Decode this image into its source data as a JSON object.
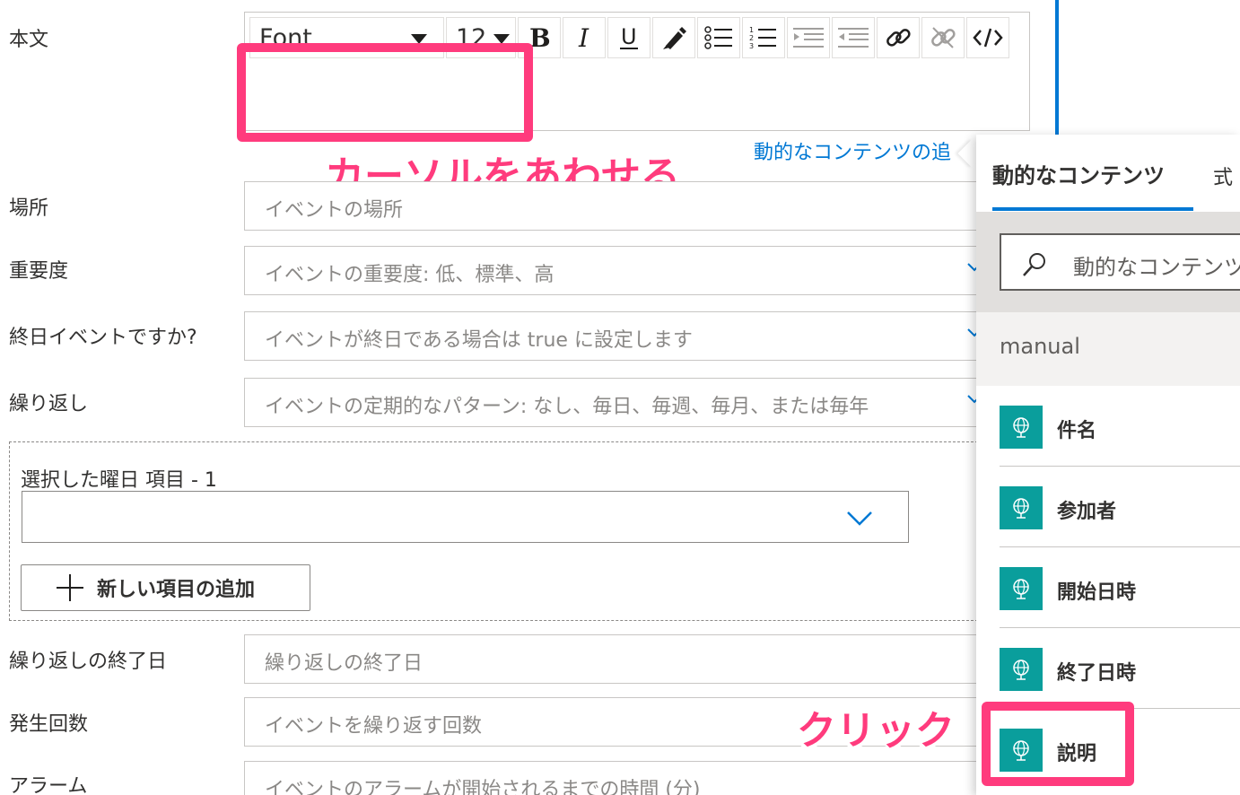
{
  "labels": {
    "body": "本文",
    "location": "場所",
    "importance": "重要度",
    "all_day": "終日イベントですか?",
    "recurrence": "繰り返し",
    "recurrence_end": "繰り返しの終了日",
    "occurrences": "発生回数",
    "alarm": "アラーム"
  },
  "toolbar": {
    "font": "Font",
    "size": "12"
  },
  "fields": {
    "location_placeholder": "イベントの場所",
    "importance_placeholder": "イベントの重要度: 低、標準、高",
    "all_day_placeholder": "イベントが終日である場合は true に設定します",
    "recurrence_placeholder": "イベントの定期的なパターン: なし、毎日、毎週、毎月、または毎年",
    "recurrence_end_placeholder": "繰り返しの終了日",
    "occurrences_placeholder": "イベントを繰り返す回数",
    "alarm_placeholder": "イベントのアラームが開始されるまでの時間 (分)"
  },
  "dynamic_link": "動的なコンテンツの追",
  "repeat_section": {
    "label": "選択した曜日 項目 - 1",
    "add_button": "新しい項目の追加"
  },
  "annotations": {
    "cursor": "カーソルをあわせる",
    "click": "クリック"
  },
  "panel": {
    "tab": "動的なコンテンツ",
    "tab2": "式",
    "search_placeholder": "動的なコンテンツ",
    "section": "manual",
    "items": [
      "件名",
      "参加者",
      "開始日時",
      "終了日時",
      "説明"
    ]
  },
  "colors": {
    "accent": "#0078d4",
    "annotation": "#ff3b7d",
    "token_icon": "#0a9e9c"
  }
}
